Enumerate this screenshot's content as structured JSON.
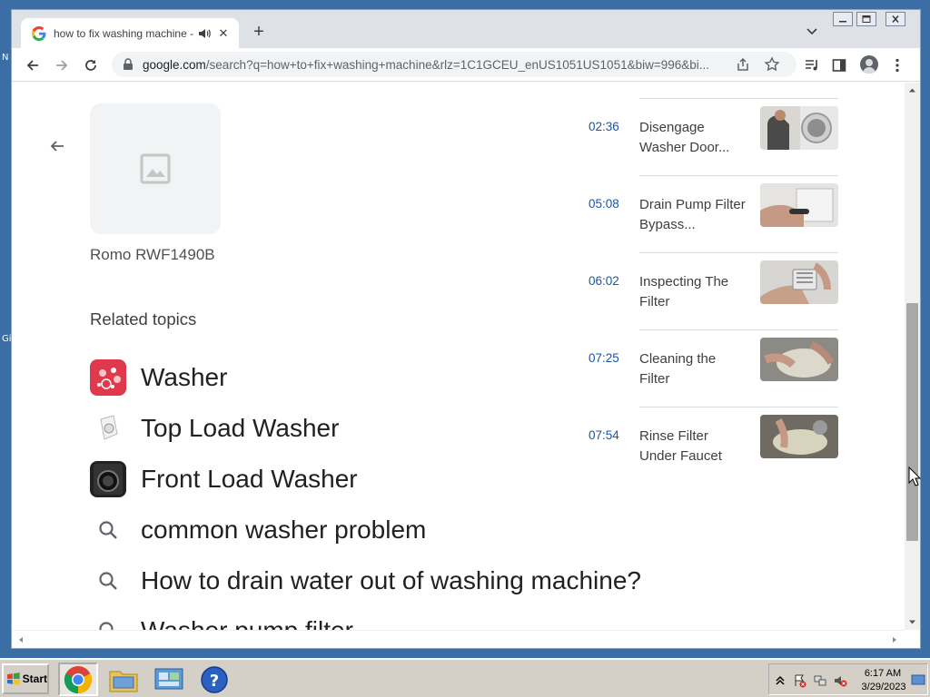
{
  "desktop": {
    "fragments": [
      "N",
      "Gi"
    ]
  },
  "browser": {
    "tab": {
      "title": "how to fix washing machine - G"
    },
    "new_tab_symbol": "+",
    "toolbar": {
      "url_host": "google.com",
      "url_path": "/search?q=how+to+fix+washing+machine&rlz=1C1GCEU_enUS1051US1051&biw=996&bi..."
    }
  },
  "page": {
    "product_name": "Romo RWF1490B",
    "related_heading": "Related topics",
    "related_topics": [
      {
        "label": "Washer",
        "type": "entity"
      },
      {
        "label": "Top Load Washer",
        "type": "entity"
      },
      {
        "label": "Front Load Washer",
        "type": "entity"
      },
      {
        "label": "common washer problem",
        "type": "search"
      },
      {
        "label": "How to drain water out of washing machine?",
        "type": "search"
      },
      {
        "label": "Washer pump filter",
        "type": "search"
      }
    ],
    "video_chapters": [
      {
        "time": "02:36",
        "title": "Disengage Washer Door..."
      },
      {
        "time": "05:08",
        "title": "Drain Pump Filter Bypass..."
      },
      {
        "time": "06:02",
        "title": "Inspecting The Filter"
      },
      {
        "time": "07:25",
        "title": "Cleaning the Filter"
      },
      {
        "time": "07:54",
        "title": "Rinse Filter Under Faucet"
      }
    ]
  },
  "taskbar": {
    "start_label": "Start",
    "clock_time": "6:17 AM",
    "clock_date": "3/29/2023"
  },
  "colors": {
    "link_blue": "#1a55a8",
    "desktop": "#3a6ea5",
    "taskbar": "#d4d0c8"
  }
}
